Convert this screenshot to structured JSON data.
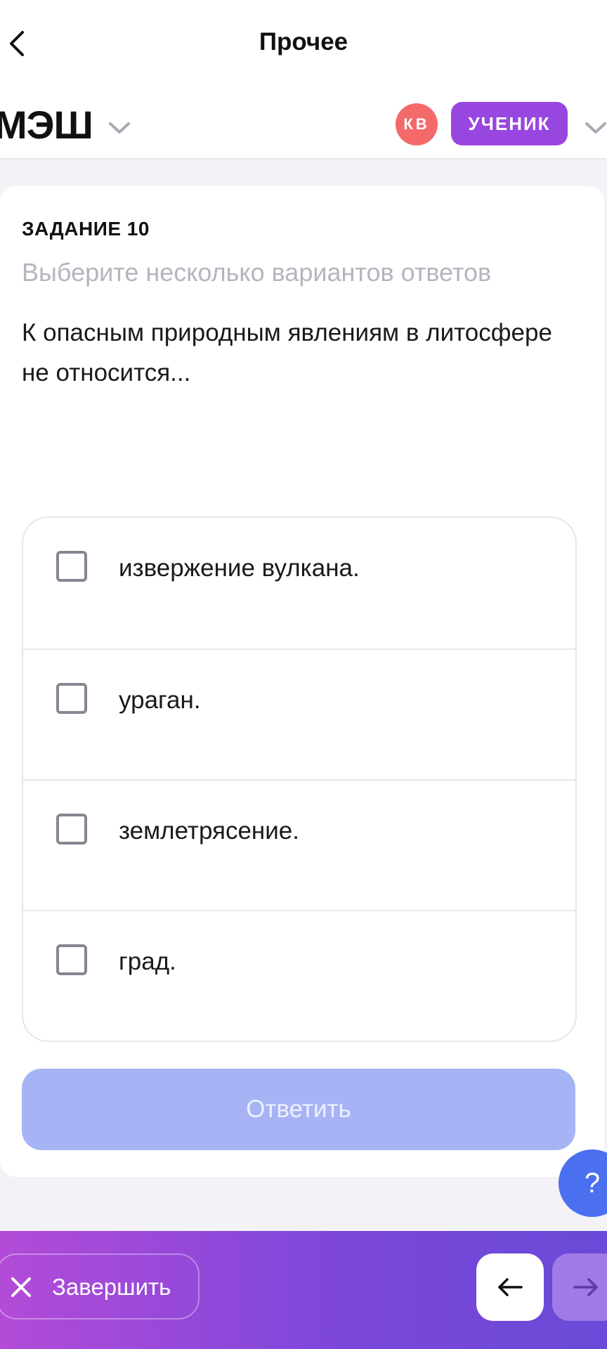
{
  "topnav": {
    "title": "Прочее"
  },
  "header": {
    "logo": "МЭШ",
    "avatar_initials": "КВ",
    "role": "УЧЕНИК"
  },
  "task": {
    "number": "ЗАДАНИЕ 10",
    "hint": "Выберите несколько вариантов ответов",
    "question": "К опасным природным явлениям в литосфере не относится...",
    "options": [
      {
        "label": "извержение вулкана.",
        "checked": false
      },
      {
        "label": "ураган.",
        "checked": false
      },
      {
        "label": "землетрясение.",
        "checked": false
      },
      {
        "label": "град.",
        "checked": false
      }
    ],
    "answer_label": "Ответить"
  },
  "help": {
    "label": "?"
  },
  "bottombar": {
    "finish_label": "Завершить"
  },
  "colors": {
    "accent_purple": "#9846e0",
    "avatar_red": "#f46a6a",
    "answer_disabled": "#a6b4f6",
    "help_blue": "#4a70f0"
  }
}
